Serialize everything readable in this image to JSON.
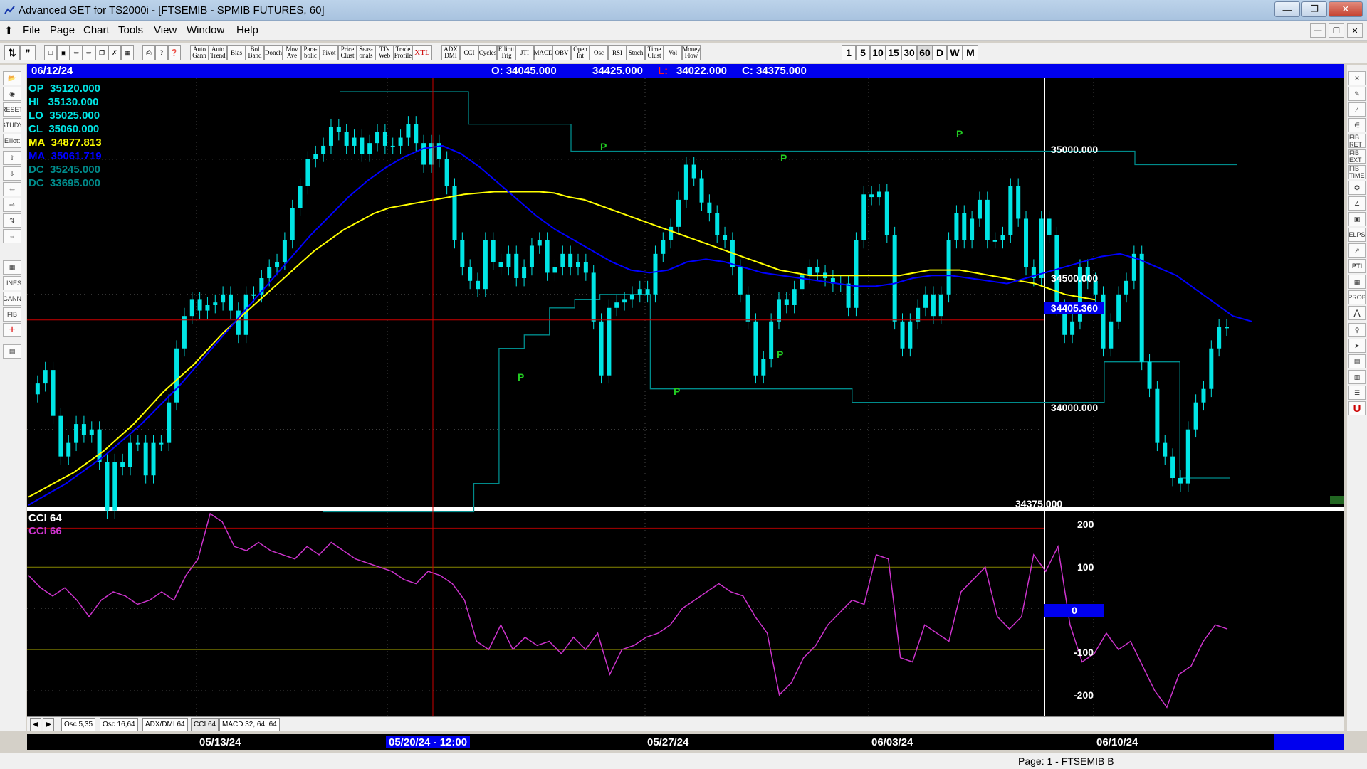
{
  "window": {
    "title": "Advanced GET for TS2000i - [FTSEMIB - SPMIB FUTURES, 60]"
  },
  "menu": [
    "File",
    "Page",
    "Chart",
    "Tools",
    "View",
    "Window",
    "Help"
  ],
  "toolbar": {
    "study_buttons": [
      "Auto Gann",
      "Auto Trend",
      "Bias",
      "Bol Band",
      "Donch",
      "Mov Ave",
      "Para-bolic",
      "Pivot",
      "Price Clust",
      "Seas-onals",
      "TJ's Web",
      "Trade Profile",
      "XTL"
    ],
    "osc_buttons": [
      "ADX DMI",
      "CCI",
      "Cycles",
      "Elliott Trig",
      "JTI",
      "MACD",
      "OBV",
      "Open Int",
      "Osc",
      "RSI",
      "Stoch",
      "Time Clust",
      "Vol",
      "Money Flow"
    ],
    "interval_buttons": [
      "1",
      "5",
      "10",
      "15",
      "30",
      "60",
      "D",
      "W",
      "M"
    ]
  },
  "left_tools": [
    "RESET",
    "STUDY",
    "Elliott",
    "LINES",
    "GANN",
    "FIB"
  ],
  "right_tools": [
    "FIB RET",
    "FIB EXT",
    "FIB TIME",
    "ELPS",
    "PTI",
    "PROB",
    "A",
    "U"
  ],
  "info_bar": {
    "date": "06/12/24",
    "open": "O: 34045.000",
    "high": "34425.000",
    "low_label": "L:",
    "low_value": "34022.000",
    "close": "C: 34375.000"
  },
  "overlays": [
    {
      "label": "OP",
      "value": "35120.000",
      "color": "#00e5e5"
    },
    {
      "label": "HI",
      "value": "35130.000",
      "color": "#00e5e5"
    },
    {
      "label": "LO",
      "value": "35025.000",
      "color": "#00e5e5"
    },
    {
      "label": "CL",
      "value": "35060.000",
      "color": "#00e5e5"
    },
    {
      "label": "MA",
      "value": "34877.813",
      "color": "#ffff00"
    },
    {
      "label": "MA",
      "value": "35061.719",
      "color": "#0000ff"
    },
    {
      "label": "DC",
      "value": "35245.000",
      "color": "#008b8b"
    },
    {
      "label": "DC",
      "value": "33695.000",
      "color": "#008b8b"
    }
  ],
  "price_axis": {
    "ticks": [
      "35000.000",
      "34500.000",
      "34000.000"
    ],
    "crosshair_price": "34405.360",
    "last_price": "34375.000"
  },
  "pivot_label": "P",
  "cci_panel": {
    "legend": [
      "CCI 64",
      "CCI  66"
    ],
    "ticks": [
      "200",
      "100",
      "0",
      "-100",
      "-200"
    ]
  },
  "tabs": [
    "Osc 5,35",
    "Osc 16,64",
    "ADX/DMI 64",
    "CCI 64",
    "MACD 32, 64, 64"
  ],
  "dates": [
    "05/13/24",
    "05/20/24 - 12:00",
    "05/27/24",
    "06/03/24",
    "06/10/24"
  ],
  "status": "Page: 1 - FTSEMIB B",
  "colors": {
    "candle": "#00e5e5",
    "ma_fast": "#ffff00",
    "ma_slow": "#0000ff",
    "donchian": "#008b8b",
    "cci": "#cc33cc",
    "pivot": "#22cc22",
    "crosshair": "#cc0000",
    "highlight": "#0000ee"
  },
  "chart_data": {
    "type": "line",
    "price_ylim": [
      33720,
      35300
    ],
    "cci_ylim": [
      -250,
      230
    ],
    "price_series": [
      34130,
      34170,
      34220,
      34050,
      33900,
      33950,
      34020,
      33980,
      34000,
      33880,
      33700,
      33880,
      33860,
      33950,
      33950,
      33830,
      33950,
      33950,
      34100,
      34300,
      34420,
      34480,
      34440,
      34460,
      34470,
      34500,
      34440,
      34350,
      34500,
      34500,
      34560,
      34600,
      34620,
      34700,
      34820,
      34900,
      35000,
      35020,
      35050,
      35120,
      35100,
      35050,
      35080,
      35020,
      35060,
      35100,
      35050,
      35050,
      35080,
      35130,
      35060,
      34980,
      35060,
      35000,
      34900,
      34700,
      34600,
      34550,
      34520,
      34700,
      34620,
      34600,
      34650,
      34560,
      34600,
      34680,
      34700,
      34580,
      34600,
      34650,
      34600,
      34620,
      34580,
      34400,
      34200,
      34450,
      34470,
      34480,
      34500,
      34520,
      34500,
      34650,
      34700,
      34750,
      34850,
      34980,
      34930,
      34840,
      34800,
      34720,
      34700,
      34600,
      34500,
      34400,
      34200,
      34260,
      34400,
      34480,
      34460,
      34520,
      34570,
      34600,
      34580,
      34560,
      34540,
      34540,
      34450,
      34700,
      34870,
      34860,
      34880,
      34720,
      34400,
      34300,
      34400,
      34450,
      34500,
      34420,
      34500,
      34700,
      34800,
      34700,
      34780,
      34850,
      34700,
      34700,
      34720,
      34900,
      34780,
      34600,
      34560,
      34780,
      34720,
      34450,
      34350,
      34400,
      34600,
      34550,
      34500,
      34300,
      34400,
      34500,
      34550,
      34650,
      34250,
      34150,
      33950,
      33900,
      33820,
      33800,
      34000,
      34100,
      34150,
      34300,
      34380,
      34375
    ],
    "ma_fast": [
      33750,
      33780,
      33810,
      33840,
      33880,
      33920,
      33970,
      34020,
      34080,
      34140,
      34190,
      34240,
      34300,
      34360,
      34410,
      34460,
      34510,
      34560,
      34610,
      34660,
      34700,
      34740,
      34770,
      34800,
      34820,
      34830,
      34840,
      34850,
      34860,
      34870,
      34875,
      34880,
      34880,
      34880,
      34880,
      34875,
      34860,
      34850,
      34830,
      34810,
      34790,
      34770,
      34750,
      34730,
      34710,
      34690,
      34670,
      34650,
      34630,
      34610,
      34590,
      34580,
      34570,
      34570,
      34570,
      34570,
      34570,
      34570,
      34570,
      34580,
      34590,
      34590,
      34590,
      34580,
      34570,
      34560,
      34550,
      34540,
      34520,
      34500,
      34490,
      34480
    ],
    "ma_slow": [
      33720,
      33760,
      33800,
      33850,
      33900,
      33960,
      34020,
      34090,
      34160,
      34240,
      34320,
      34400,
      34480,
      34560,
      34640,
      34720,
      34790,
      34860,
      34920,
      34970,
      35010,
      35040,
      35050,
      35020,
      34970,
      34910,
      34850,
      34790,
      34740,
      34700,
      34660,
      34620,
      34590,
      34580,
      34590,
      34620,
      34630,
      34620,
      34600,
      34580,
      34570,
      34560,
      34550,
      34540,
      34530,
      34530,
      34540,
      34560,
      34570,
      34570,
      34560,
      34550,
      34540,
      34560,
      34580,
      34600,
      34620,
      34640,
      34650,
      34630,
      34600,
      34570,
      34520,
      34470,
      34420,
      34400
    ],
    "donchian_upper": [
      35250,
      35250,
      35250,
      35250,
      35250,
      35130,
      35130,
      35130,
      35130,
      35030,
      35030,
      35030,
      35030,
      35030,
      35030,
      35030,
      35030,
      35030,
      35030,
      35030,
      35030,
      35030,
      35030,
      35030,
      35030,
      35030,
      35030,
      35030,
      35030,
      35030,
      35030,
      34980,
      34980,
      34980,
      34980
    ],
    "donchian_lower": [
      33695,
      33695,
      33695,
      33695,
      33695,
      33695,
      33800,
      34300,
      34350,
      34450,
      34480,
      34500,
      34500,
      34150,
      34150,
      34150,
      34150,
      34150,
      34150,
      34150,
      34150,
      34100,
      34100,
      34100,
      34100,
      34100,
      34100,
      34100,
      34100,
      34100,
      34100,
      34250,
      34250,
      34250,
      33820,
      33820
    ],
    "cci": [
      80,
      50,
      30,
      50,
      20,
      -20,
      20,
      40,
      30,
      10,
      20,
      40,
      20,
      80,
      120,
      230,
      210,
      150,
      140,
      160,
      140,
      130,
      120,
      150,
      130,
      160,
      140,
      120,
      110,
      100,
      90,
      70,
      60,
      90,
      80,
      60,
      20,
      -80,
      -100,
      -40,
      -100,
      -70,
      -90,
      -80,
      -110,
      -70,
      -100,
      -60,
      -160,
      -100,
      -90,
      -70,
      -60,
      -40,
      0,
      20,
      40,
      60,
      40,
      30,
      -20,
      -60,
      -210,
      -180,
      -120,
      -90,
      -40,
      -10,
      20,
      10,
      130,
      120,
      -120,
      -130,
      -40,
      -60,
      -80,
      40,
      70,
      100,
      -20,
      -50,
      -20,
      130,
      90,
      150,
      -40,
      -130,
      -110,
      -60,
      -100,
      -80,
      -140,
      -200,
      -240,
      -160,
      -140,
      -80,
      -40,
      -50
    ]
  }
}
